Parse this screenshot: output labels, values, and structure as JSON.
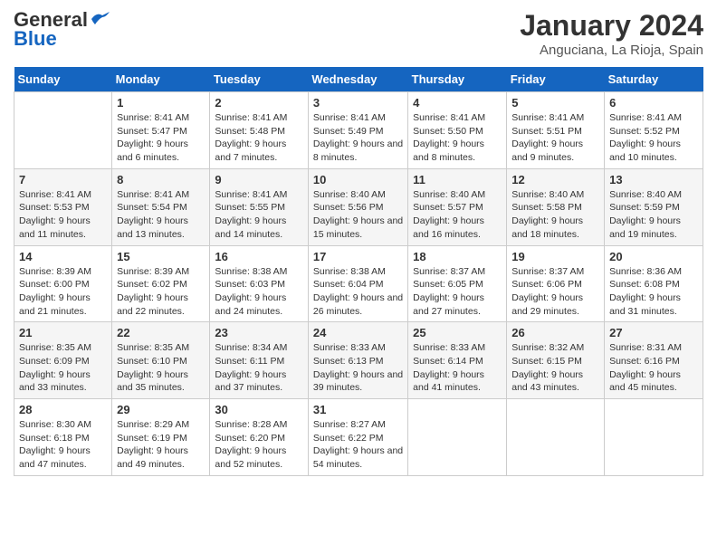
{
  "header": {
    "logo_line1": "General",
    "logo_line2": "Blue",
    "month": "January 2024",
    "location": "Anguciana, La Rioja, Spain"
  },
  "weekdays": [
    "Sunday",
    "Monday",
    "Tuesday",
    "Wednesday",
    "Thursday",
    "Friday",
    "Saturday"
  ],
  "weeks": [
    [
      {
        "day": "",
        "sunrise": "",
        "sunset": "",
        "daylight": ""
      },
      {
        "day": "1",
        "sunrise": "Sunrise: 8:41 AM",
        "sunset": "Sunset: 5:47 PM",
        "daylight": "Daylight: 9 hours and 6 minutes."
      },
      {
        "day": "2",
        "sunrise": "Sunrise: 8:41 AM",
        "sunset": "Sunset: 5:48 PM",
        "daylight": "Daylight: 9 hours and 7 minutes."
      },
      {
        "day": "3",
        "sunrise": "Sunrise: 8:41 AM",
        "sunset": "Sunset: 5:49 PM",
        "daylight": "Daylight: 9 hours and 8 minutes."
      },
      {
        "day": "4",
        "sunrise": "Sunrise: 8:41 AM",
        "sunset": "Sunset: 5:50 PM",
        "daylight": "Daylight: 9 hours and 8 minutes."
      },
      {
        "day": "5",
        "sunrise": "Sunrise: 8:41 AM",
        "sunset": "Sunset: 5:51 PM",
        "daylight": "Daylight: 9 hours and 9 minutes."
      },
      {
        "day": "6",
        "sunrise": "Sunrise: 8:41 AM",
        "sunset": "Sunset: 5:52 PM",
        "daylight": "Daylight: 9 hours and 10 minutes."
      }
    ],
    [
      {
        "day": "7",
        "sunrise": "Sunrise: 8:41 AM",
        "sunset": "Sunset: 5:53 PM",
        "daylight": "Daylight: 9 hours and 11 minutes."
      },
      {
        "day": "8",
        "sunrise": "Sunrise: 8:41 AM",
        "sunset": "Sunset: 5:54 PM",
        "daylight": "Daylight: 9 hours and 13 minutes."
      },
      {
        "day": "9",
        "sunrise": "Sunrise: 8:41 AM",
        "sunset": "Sunset: 5:55 PM",
        "daylight": "Daylight: 9 hours and 14 minutes."
      },
      {
        "day": "10",
        "sunrise": "Sunrise: 8:40 AM",
        "sunset": "Sunset: 5:56 PM",
        "daylight": "Daylight: 9 hours and 15 minutes."
      },
      {
        "day": "11",
        "sunrise": "Sunrise: 8:40 AM",
        "sunset": "Sunset: 5:57 PM",
        "daylight": "Daylight: 9 hours and 16 minutes."
      },
      {
        "day": "12",
        "sunrise": "Sunrise: 8:40 AM",
        "sunset": "Sunset: 5:58 PM",
        "daylight": "Daylight: 9 hours and 18 minutes."
      },
      {
        "day": "13",
        "sunrise": "Sunrise: 8:40 AM",
        "sunset": "Sunset: 5:59 PM",
        "daylight": "Daylight: 9 hours and 19 minutes."
      }
    ],
    [
      {
        "day": "14",
        "sunrise": "Sunrise: 8:39 AM",
        "sunset": "Sunset: 6:00 PM",
        "daylight": "Daylight: 9 hours and 21 minutes."
      },
      {
        "day": "15",
        "sunrise": "Sunrise: 8:39 AM",
        "sunset": "Sunset: 6:02 PM",
        "daylight": "Daylight: 9 hours and 22 minutes."
      },
      {
        "day": "16",
        "sunrise": "Sunrise: 8:38 AM",
        "sunset": "Sunset: 6:03 PM",
        "daylight": "Daylight: 9 hours and 24 minutes."
      },
      {
        "day": "17",
        "sunrise": "Sunrise: 8:38 AM",
        "sunset": "Sunset: 6:04 PM",
        "daylight": "Daylight: 9 hours and 26 minutes."
      },
      {
        "day": "18",
        "sunrise": "Sunrise: 8:37 AM",
        "sunset": "Sunset: 6:05 PM",
        "daylight": "Daylight: 9 hours and 27 minutes."
      },
      {
        "day": "19",
        "sunrise": "Sunrise: 8:37 AM",
        "sunset": "Sunset: 6:06 PM",
        "daylight": "Daylight: 9 hours and 29 minutes."
      },
      {
        "day": "20",
        "sunrise": "Sunrise: 8:36 AM",
        "sunset": "Sunset: 6:08 PM",
        "daylight": "Daylight: 9 hours and 31 minutes."
      }
    ],
    [
      {
        "day": "21",
        "sunrise": "Sunrise: 8:35 AM",
        "sunset": "Sunset: 6:09 PM",
        "daylight": "Daylight: 9 hours and 33 minutes."
      },
      {
        "day": "22",
        "sunrise": "Sunrise: 8:35 AM",
        "sunset": "Sunset: 6:10 PM",
        "daylight": "Daylight: 9 hours and 35 minutes."
      },
      {
        "day": "23",
        "sunrise": "Sunrise: 8:34 AM",
        "sunset": "Sunset: 6:11 PM",
        "daylight": "Daylight: 9 hours and 37 minutes."
      },
      {
        "day": "24",
        "sunrise": "Sunrise: 8:33 AM",
        "sunset": "Sunset: 6:13 PM",
        "daylight": "Daylight: 9 hours and 39 minutes."
      },
      {
        "day": "25",
        "sunrise": "Sunrise: 8:33 AM",
        "sunset": "Sunset: 6:14 PM",
        "daylight": "Daylight: 9 hours and 41 minutes."
      },
      {
        "day": "26",
        "sunrise": "Sunrise: 8:32 AM",
        "sunset": "Sunset: 6:15 PM",
        "daylight": "Daylight: 9 hours and 43 minutes."
      },
      {
        "day": "27",
        "sunrise": "Sunrise: 8:31 AM",
        "sunset": "Sunset: 6:16 PM",
        "daylight": "Daylight: 9 hours and 45 minutes."
      }
    ],
    [
      {
        "day": "28",
        "sunrise": "Sunrise: 8:30 AM",
        "sunset": "Sunset: 6:18 PM",
        "daylight": "Daylight: 9 hours and 47 minutes."
      },
      {
        "day": "29",
        "sunrise": "Sunrise: 8:29 AM",
        "sunset": "Sunset: 6:19 PM",
        "daylight": "Daylight: 9 hours and 49 minutes."
      },
      {
        "day": "30",
        "sunrise": "Sunrise: 8:28 AM",
        "sunset": "Sunset: 6:20 PM",
        "daylight": "Daylight: 9 hours and 52 minutes."
      },
      {
        "day": "31",
        "sunrise": "Sunrise: 8:27 AM",
        "sunset": "Sunset: 6:22 PM",
        "daylight": "Daylight: 9 hours and 54 minutes."
      },
      {
        "day": "",
        "sunrise": "",
        "sunset": "",
        "daylight": ""
      },
      {
        "day": "",
        "sunrise": "",
        "sunset": "",
        "daylight": ""
      },
      {
        "day": "",
        "sunrise": "",
        "sunset": "",
        "daylight": ""
      }
    ]
  ]
}
